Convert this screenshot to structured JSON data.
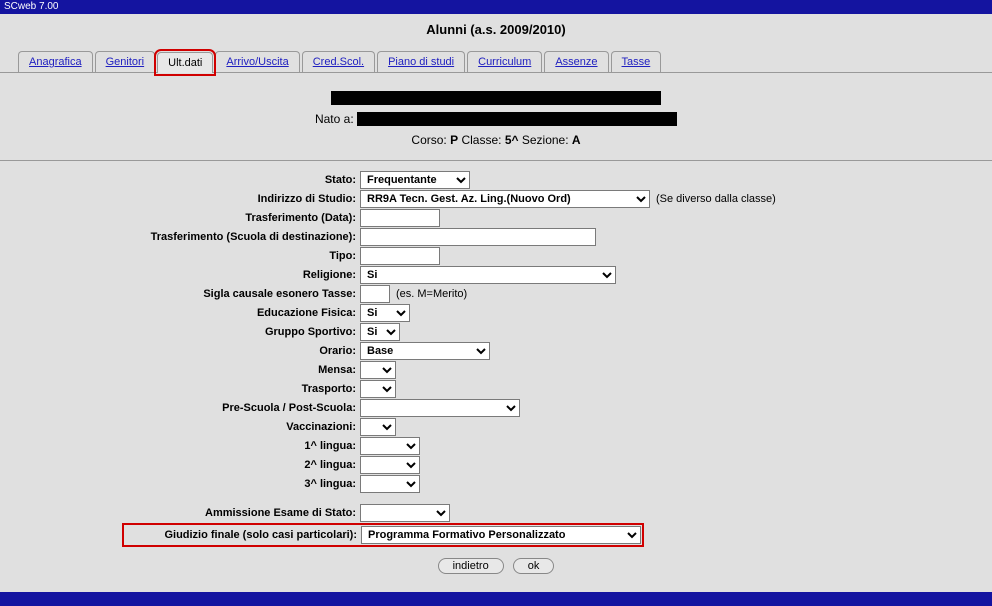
{
  "window": {
    "title": "SCweb 7.00"
  },
  "header": {
    "title": "Alunni (a.s. 2009/2010)"
  },
  "tabs": {
    "t0": "Anagrafica",
    "t1": "Genitori",
    "t2": "Ult.dati",
    "t3": "Arrivo/Uscita",
    "t4": "Cred.Scol.",
    "t5": "Piano di studi",
    "t6": "Curriculum",
    "t7": "Assenze",
    "t8": "Tasse"
  },
  "student": {
    "born_label": "Nato a:",
    "corso_label": "Corso:",
    "corso_value": "P",
    "classe_label": "Classe:",
    "classe_value": "5^",
    "sezione_label": "Sezione:",
    "sezione_value": "A"
  },
  "form": {
    "stato": {
      "label": "Stato:",
      "value": "Frequentante"
    },
    "indirizzo": {
      "label": "Indirizzo di Studio:",
      "value": "RR9A Tecn. Gest. Az. Ling.(Nuovo Ord)",
      "hint": "(Se diverso dalla classe)"
    },
    "trasf_data": {
      "label": "Trasferimento (Data):",
      "value": ""
    },
    "trasf_scuola": {
      "label": "Trasferimento (Scuola di destinazione):",
      "value": ""
    },
    "tipo": {
      "label": "Tipo:",
      "value": ""
    },
    "religione": {
      "label": "Religione:",
      "value": "Si"
    },
    "sigla_tasse": {
      "label": "Sigla causale esonero Tasse:",
      "value": "",
      "hint": "(es. M=Merito)"
    },
    "ed_fisica": {
      "label": "Educazione Fisica:",
      "value": "Si"
    },
    "gruppo_sport": {
      "label": "Gruppo Sportivo:",
      "value": "Si"
    },
    "orario": {
      "label": "Orario:",
      "value": "Base"
    },
    "mensa": {
      "label": "Mensa:",
      "value": ""
    },
    "trasporto": {
      "label": "Trasporto:",
      "value": ""
    },
    "pre_post": {
      "label": "Pre-Scuola / Post-Scuola:",
      "value": ""
    },
    "vaccinazioni": {
      "label": "Vaccinazioni:",
      "value": ""
    },
    "lingua1": {
      "label": "1^ lingua:",
      "value": ""
    },
    "lingua2": {
      "label": "2^ lingua:",
      "value": ""
    },
    "lingua3": {
      "label": "3^ lingua:",
      "value": ""
    },
    "ammissione": {
      "label": "Ammissione Esame di Stato:",
      "value": ""
    },
    "giudizio": {
      "label": "Giudizio finale (solo casi particolari):",
      "value": "Programma Formativo Personalizzato"
    }
  },
  "buttons": {
    "back": "indietro",
    "ok": "ok"
  }
}
